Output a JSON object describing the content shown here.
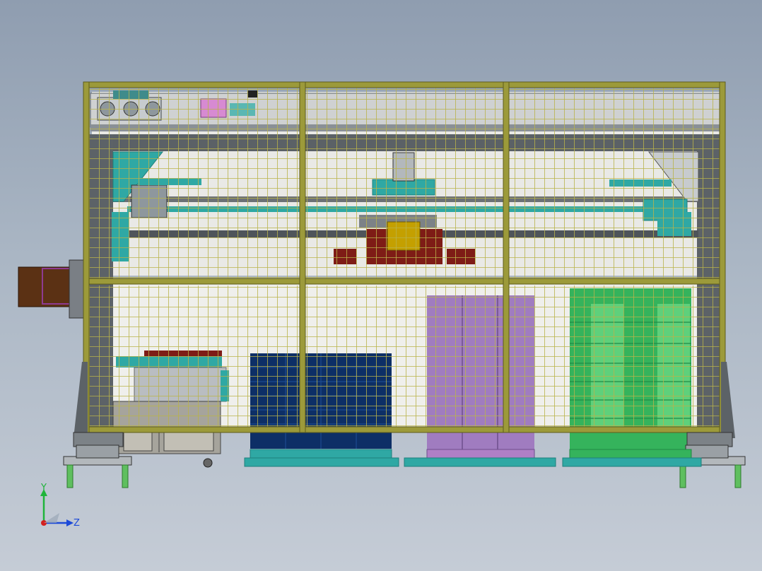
{
  "view": {
    "background_top": "#8f9db0",
    "background_bottom": "#c5ccd6"
  },
  "colors": {
    "frame": "#9c9a3a",
    "frame_dark": "#6f6d22",
    "mesh": "#b7b248",
    "beam": "#555a5f",
    "beam_light": "#7c8287",
    "teal": "#2fa8a4",
    "teal_dark": "#1e7f7c",
    "maroon": "#7e1c16",
    "navy": "#0d2f66",
    "violet": "#a07cc0",
    "green": "#35b35c",
    "brown": "#5b3114",
    "cabinet": "#a6a49c",
    "leg": "#5fbf5f"
  },
  "triad": {
    "y_label": "Y",
    "z_label": "Z",
    "y_color": "#1fb43a",
    "z_color": "#1d4ad8",
    "x_color": "#d32020"
  }
}
